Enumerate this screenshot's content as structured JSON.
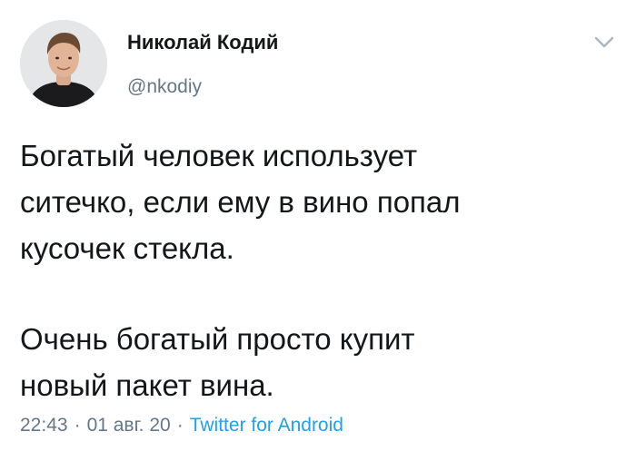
{
  "author": {
    "display_name": "Николай Кодий",
    "handle": "@nkodiy"
  },
  "tweet": {
    "paragraph_1_lines": [
      "Богатый человек использует",
      "ситечко, если ему в вино попал",
      "кусочек стекла."
    ],
    "paragraph_2_lines": [
      "Очень богатый просто купит",
      "новый пакет вина."
    ]
  },
  "meta": {
    "time": "22:43",
    "date": "01 авг. 20",
    "separator": "·",
    "source": "Twitter for Android"
  },
  "icons": {
    "menu": "chevron-down-icon",
    "avatar": "profile-photo"
  },
  "colors": {
    "text": "#14171a",
    "secondary": "#657786",
    "link": "#1da1f2"
  }
}
